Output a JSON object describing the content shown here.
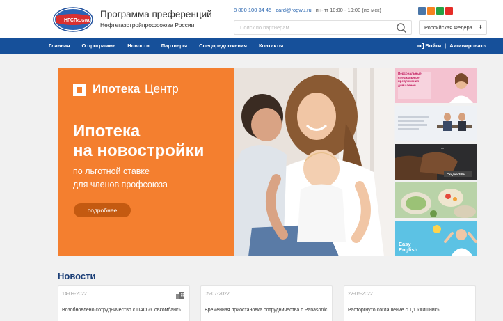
{
  "header": {
    "logo": {
      "left_text": "НГСП",
      "right_text": "ROGWU"
    },
    "title": "Программа преференций",
    "subtitle": "Нефтегазстройпрофсоюза России",
    "phone": "8 800 100 34 45",
    "email": "card@rogwu.ru",
    "hours": "пн-пт 10:00 - 19:00 (по мск)",
    "search_placeholder": "Поиск по партнерам",
    "country_select": "Российская Федера",
    "socials": [
      {
        "name": "vk-icon",
        "color": "#4a76a8"
      },
      {
        "name": "ok-icon",
        "color": "#f58220"
      },
      {
        "name": "whatsapp-icon",
        "color": "#25a244"
      },
      {
        "name": "youtube-icon",
        "color": "#e52d27"
      }
    ]
  },
  "nav": {
    "items": [
      "Главная",
      "О программе",
      "Новости",
      "Партнеры",
      "Спецпредложения",
      "Контакты"
    ],
    "login": "Войти",
    "activate": "Активировать"
  },
  "banner": {
    "logo_bold": "Ипотека",
    "logo_light": "Центр",
    "headline_line1": "Ипотека",
    "headline_line2": "на новостройки",
    "sub_line1": "по льготной ставке",
    "sub_line2": "для членов профсоюза",
    "button": "подробнее"
  },
  "promos": [
    {
      "bg": "#f5c6d2",
      "text": "Персональные\nспециальные\nпредложения\nдля членов"
    },
    {
      "bg": "#eef2f6",
      "text": ""
    },
    {
      "bg": "#3a3a3a",
      "text": "Скидка 20%"
    },
    {
      "bg": "#9dc38a",
      "text": ""
    },
    {
      "bg": "#5ec4e6",
      "text": "Easy\nEnglish"
    }
  ],
  "news": {
    "title": "Новости",
    "items": [
      {
        "date": "14-09-2022",
        "text": "Возобновлено сотрудничество с ПАО «Совкомбанк»"
      },
      {
        "date": "05-07-2022",
        "text": "Временная приостановка сотрудничества с Panasonic"
      },
      {
        "date": "22-06-2022",
        "text": "Расторгнуто соглашение с ТД «Хищник»"
      }
    ]
  }
}
